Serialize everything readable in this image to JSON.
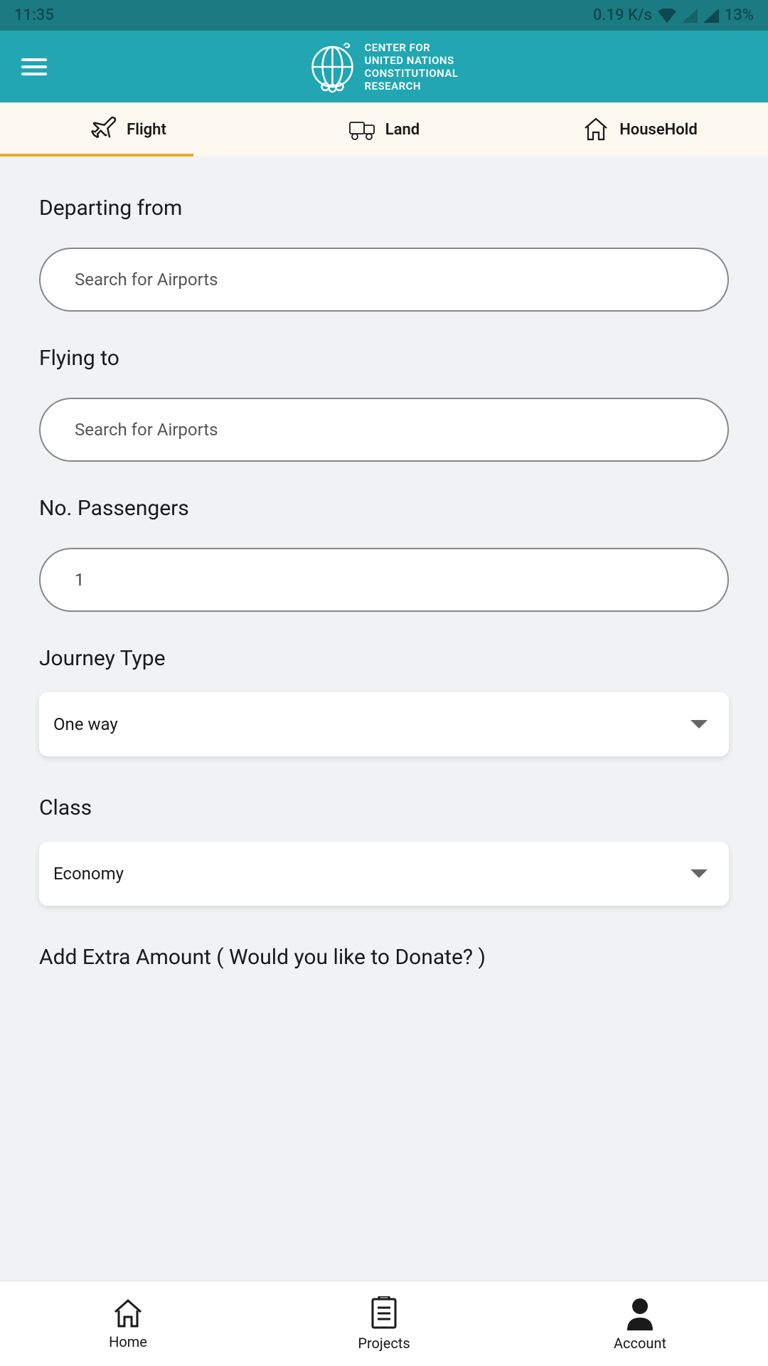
{
  "status_bar": {
    "time": "11:35",
    "data_speed": "0.19 K/s",
    "battery": "13%"
  },
  "header": {
    "title_line1": "CENTER FOR",
    "title_line2": "UNITED NATIONS",
    "title_line3": "CONSTITUTIONAL",
    "title_line4": "RESEARCH"
  },
  "tabs": [
    {
      "label": "Flight",
      "active": true
    },
    {
      "label": "Land",
      "active": false
    },
    {
      "label": "HouseHold",
      "active": false
    }
  ],
  "form": {
    "departing_label": "Departing from",
    "departing_placeholder": "Search for Airports",
    "flying_label": "Flying to",
    "flying_placeholder": "Search for Airports",
    "passengers_label": "No. Passengers",
    "passengers_value": "1",
    "journey_label": "Journey Type",
    "journey_value": "One way",
    "class_label": "Class",
    "class_value": "Economy",
    "donate_label": "Add Extra Amount ( Would you like to Donate? )"
  },
  "bottom_nav": [
    {
      "label": "Home"
    },
    {
      "label": "Projects"
    },
    {
      "label": "Account"
    }
  ]
}
